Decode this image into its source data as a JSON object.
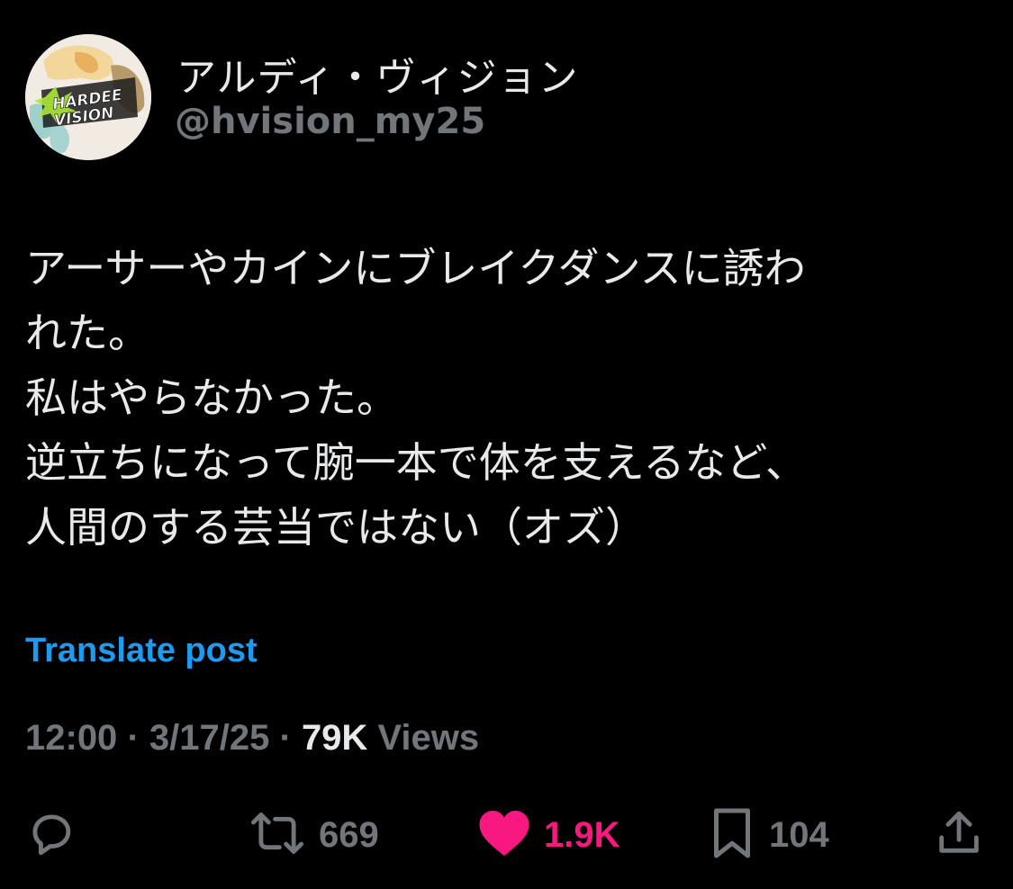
{
  "author": {
    "display_name": "アルディ・ヴィジョン",
    "handle": "@hvision_my25",
    "avatar_text": "HARDEE VISION"
  },
  "post": {
    "lines": [
      "アーサーやカインにブレイクダンスに誘わ",
      "れた。",
      "私はやらなかった。",
      "逆立ちになって腕一本で体を支えるなど、",
      "人間のする芸当ではない（オズ）"
    ],
    "translate_label": "Translate post"
  },
  "meta": {
    "time": "12:00",
    "separator": "·",
    "date": "3/17/25",
    "views_count": "79K",
    "views_label": "Views"
  },
  "actions": {
    "reply": {
      "icon": "reply-icon"
    },
    "repost": {
      "icon": "repost-icon",
      "count": "669"
    },
    "like": {
      "icon": "heart-icon",
      "count": "1.9K",
      "color": "#f91880"
    },
    "bookmark": {
      "icon": "bookmark-icon",
      "count": "104"
    },
    "share": {
      "icon": "share-icon"
    }
  },
  "colors": {
    "background": "#000000",
    "text": "#e7e9ea",
    "muted": "#71767b",
    "link": "#1d9bf0",
    "like": "#f91880"
  }
}
